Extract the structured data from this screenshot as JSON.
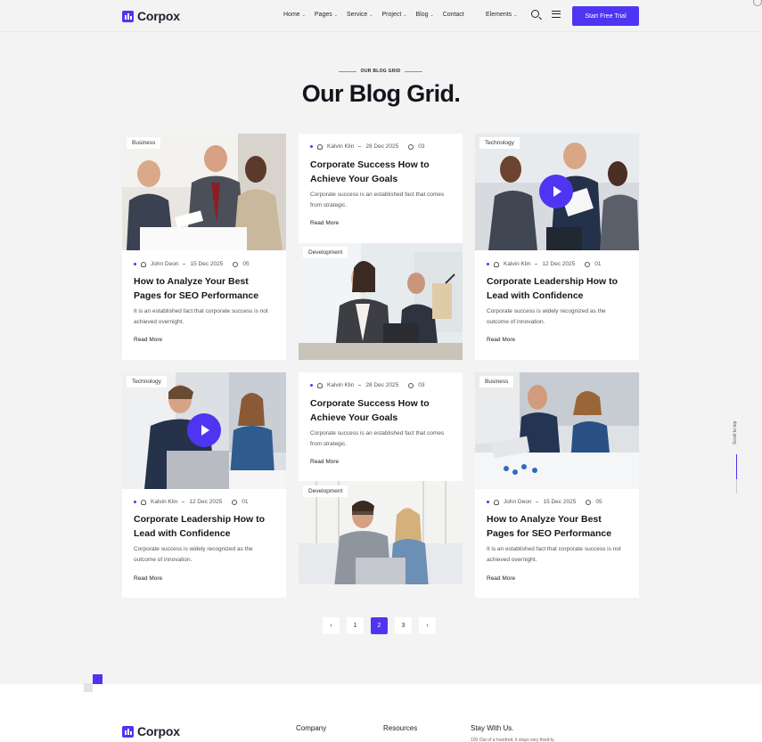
{
  "brand": {
    "name": "Corpox",
    "accent": "#4f35f2"
  },
  "nav": {
    "items": [
      {
        "label": "Home",
        "dropdown": true
      },
      {
        "label": "Pages",
        "dropdown": true
      },
      {
        "label": "Service",
        "dropdown": true
      },
      {
        "label": "Project",
        "dropdown": true
      },
      {
        "label": "Blog",
        "dropdown": true
      },
      {
        "label": "Contact",
        "dropdown": false
      }
    ],
    "elements_label": "Elements",
    "cta_label": "Start Free Trial"
  },
  "section": {
    "eyebrow": "OUR BLOG GRID",
    "title": "Our Blog Grid."
  },
  "posts": [
    {
      "category": "Business",
      "author": "John Deon",
      "date": "15 Dec 2025",
      "comments": "05",
      "title": "How to Analyze Your Best Pages for SEO Performance",
      "excerpt": "It is an established fact that corporate success is not achieved overnight.",
      "read_more": "Read More"
    },
    {
      "category": "Development",
      "author": "Kalvin Klin",
      "date": "28 Dec 2025",
      "comments": "03",
      "title": "Corporate Success How to Achieve Your Goals",
      "excerpt": "Corporate success is an established fact that comes from strategic.",
      "read_more": "Read More"
    },
    {
      "category": "Technology",
      "author": "Kalvin Klin",
      "date": "12 Dec 2025",
      "comments": "01",
      "title": "Corporate Leadership How to Lead with Confidence",
      "excerpt": "Corporate success is widely recognized as the outcome of innovation.",
      "read_more": "Read More"
    },
    {
      "category": "Technology",
      "author": "Kalvin Klin",
      "date": "12 Dec 2025",
      "comments": "01",
      "title": "Corporate Leadership How to Lead with Confidence",
      "excerpt": "Corporate success is widely recognized as the outcome of innovation.",
      "read_more": "Read More"
    },
    {
      "category": "Development",
      "author": "Kalvin Klin",
      "date": "28 Dec 2025",
      "comments": "03",
      "title": "Corporate Success How to Achieve Your Goals",
      "excerpt": "Corporate success is an established fact that comes from strategic.",
      "read_more": "Read More"
    },
    {
      "category": "Business",
      "author": "John Deon",
      "date": "15 Dec 2025",
      "comments": "05",
      "title": "How to Analyze Your Best Pages for SEO Performance",
      "excerpt": "It is an established fact that corporate success is not achieved overnight.",
      "read_more": "Read More"
    }
  ],
  "pagination": {
    "prev": "‹",
    "pages": [
      "1",
      "2",
      "3"
    ],
    "current": "2",
    "next": "›"
  },
  "scroll_top": {
    "label": "Scroll to top"
  },
  "footer": {
    "logo": "Corpox",
    "columns": [
      "Company",
      "Resources",
      "Stay With Us."
    ],
    "stay_text": "100 Out of a hundred, it stays very fixed-ly."
  },
  "icons": [
    "search-icon",
    "menu-icon",
    "user-icon",
    "comment-icon",
    "play-icon",
    "chevron-left-icon",
    "chevron-right-icon",
    "chevron-down-icon"
  ]
}
